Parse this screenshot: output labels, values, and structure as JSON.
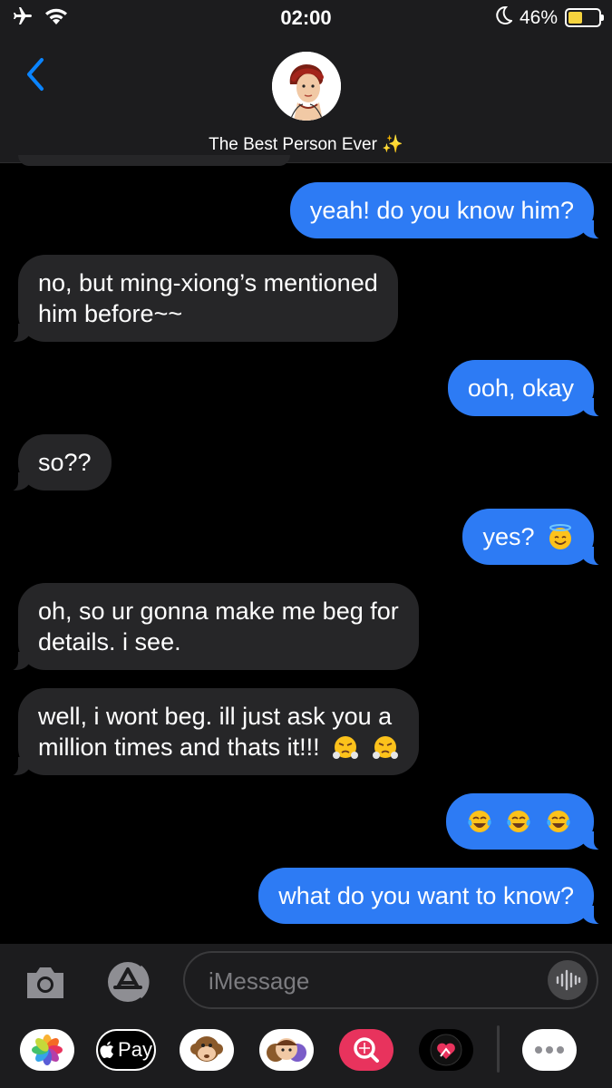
{
  "status_bar": {
    "time": "02:00",
    "battery_percent": "46%",
    "battery_level": 0.46,
    "icons": [
      "airplane-icon",
      "wifi-icon",
      "moon-icon",
      "battery-icon"
    ]
  },
  "header": {
    "contact_name": "The Best Person Ever ✨",
    "back_icon": "chevron-left-icon"
  },
  "messages": [
    {
      "from": "me",
      "text": "yeah! do you know him?"
    },
    {
      "from": "them",
      "lines": [
        "no, but ming-xiong’s mentioned",
        "him before~~"
      ]
    },
    {
      "from": "me",
      "text": "ooh, okay"
    },
    {
      "from": "them",
      "text": "so??"
    },
    {
      "from": "me",
      "text": "yes?",
      "emoji": [
        "smiling-face-with-halo"
      ]
    },
    {
      "from": "them",
      "lines": [
        "oh, so ur gonna make me beg for",
        "details. i see."
      ]
    },
    {
      "from": "them",
      "lines": [
        "well, i wont beg. ill just ask you a",
        "million times and thats it!!!"
      ],
      "emoji": [
        "face-with-steam-from-nose",
        "face-with-steam-from-nose"
      ]
    },
    {
      "from": "me",
      "text": "",
      "emoji": [
        "face-with-tears-of-joy",
        "face-with-tears-of-joy",
        "face-with-tears-of-joy"
      ]
    },
    {
      "from": "me",
      "text": "what do you want to know?"
    }
  ],
  "input": {
    "placeholder": "iMessage",
    "value": ""
  },
  "app_drawer": {
    "apple_pay_label": "Pay",
    "apps": [
      "photos-app-icon",
      "apple-pay-icon",
      "animoji-icon",
      "memoji-icon",
      "search-images-icon",
      "digital-touch-icon",
      "more-icon"
    ]
  },
  "colors": {
    "sent_bubble": "#2d7bf4",
    "received_bubble": "#262628",
    "accent": "#0a84ff"
  }
}
